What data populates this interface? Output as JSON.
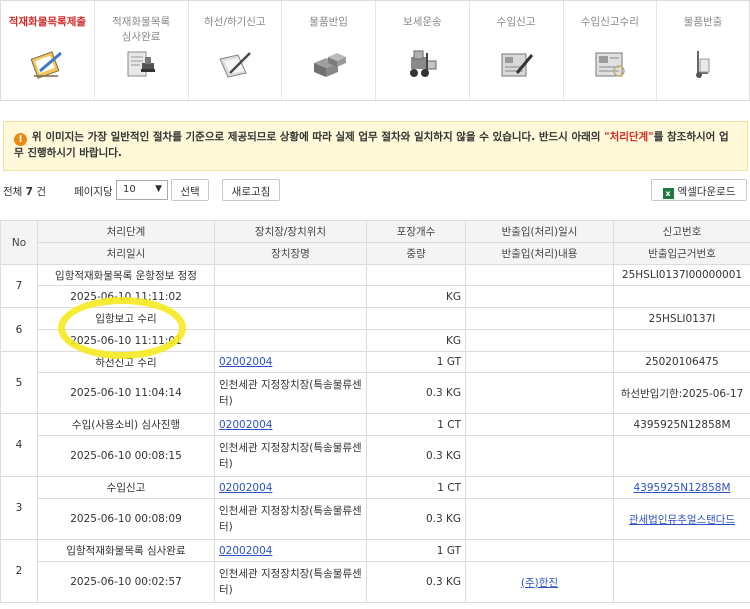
{
  "steps": [
    {
      "label": "적재화물목록제출",
      "icon": "clipboard-pencil-icon",
      "active": true
    },
    {
      "label": "적재화물목록\n심사완료",
      "icon": "document-stamp-icon",
      "active": false
    },
    {
      "label": "하선/하기신고",
      "icon": "folder-pencil-icon",
      "active": false
    },
    {
      "label": "물품반입",
      "icon": "boxes-icon",
      "active": false
    },
    {
      "label": "보세운송",
      "icon": "forklift-icon",
      "active": false
    },
    {
      "label": "수입신고",
      "icon": "form-pen-icon",
      "active": false
    },
    {
      "label": "수입신고수리",
      "icon": "approved-form-icon",
      "active": false
    },
    {
      "label": "물품반출",
      "icon": "hand-truck-icon",
      "active": false
    }
  ],
  "notice": {
    "icon": "warning-icon",
    "text_before": "위 이미지는 가장 일반적인 절차를 기준으로 제공되므로 상황에 따라 실제 업무 절차와 일치하지 않을 수 있습니다. 반드시 아래의 ",
    "highlight": "\"처리단계\"",
    "text_after": "를 참조하시어 업무 진행하시기 바랍니다."
  },
  "toolbar": {
    "total_prefix": "전체",
    "total_count": "7",
    "total_suffix": "건",
    "per_page_label": "페이지당",
    "per_page_value": "10",
    "select_button": "선택",
    "refresh_button": "새로고침",
    "excel_button": "엑셀다운로드"
  },
  "table": {
    "headers_row1": [
      "No",
      "처리단계",
      "장치장/장치위치",
      "포장개수",
      "반출입(처리)일시",
      "신고번호"
    ],
    "headers_row2": [
      "처리일시",
      "장치장명",
      "중량",
      "반출입(처리)내용",
      "반출입근거번호"
    ],
    "rows": [
      {
        "no": "7",
        "step": "입항적재화물목록 운항정보 정정",
        "location_code": "",
        "pkg": "",
        "inout_dt": "",
        "report_no": "25HSLI0137I00000001",
        "datetime": "2025-06-10 11:11:02",
        "location_name": "",
        "weight": "KG",
        "inout_content": "",
        "basis_no": ""
      },
      {
        "no": "6",
        "step": "입항보고 수리",
        "location_code": "",
        "pkg": "",
        "inout_dt": "",
        "report_no": "25HSLI0137I",
        "datetime": "2025-06-10 11:11:01",
        "location_name": "",
        "weight": "KG",
        "inout_content": "",
        "basis_no": ""
      },
      {
        "no": "5",
        "step": "하선신고 수리",
        "location_code": "02002004",
        "pkg": "1 GT",
        "inout_dt": "",
        "report_no": "25020106475",
        "datetime": "2025-06-10 11:04:14",
        "location_name": "인천세관 지정장치장(특송물류센터)",
        "weight": "0.3 KG",
        "inout_content": "",
        "basis_no": "하선반입기한:2025-06-17"
      },
      {
        "no": "4",
        "step": "수입(사용소비) 심사진행",
        "location_code": "02002004",
        "pkg": "1 CT",
        "inout_dt": "",
        "report_no": "4395925N12858M",
        "datetime": "2025-06-10 00:08:15",
        "location_name": "인천세관 지정장치장(특송물류센터)",
        "weight": "0.3 KG",
        "inout_content": "",
        "basis_no": ""
      },
      {
        "no": "3",
        "step": "수입신고",
        "location_code": "02002004",
        "pkg": "1 CT",
        "inout_dt": "",
        "report_no": "4395925N12858M",
        "datetime": "2025-06-10 00:08:09",
        "location_name": "인천세관 지정장치장(특송물류센터)",
        "weight": "0.3 KG",
        "inout_content": "",
        "basis_no": "관세법인뮤추얼스탠다드"
      },
      {
        "no": "2",
        "step": "입항적재화물목록 심사완료",
        "location_code": "02002004",
        "pkg": "1 GT",
        "inout_dt": "",
        "report_no": "",
        "datetime": "2025-06-10 00:02:57",
        "location_name": "인천세관 지정장치장(특송물류센터)",
        "weight": "0.3 KG",
        "inout_content": "(주)한진",
        "basis_no": ""
      }
    ]
  },
  "colors": {
    "accent_red": "#d32a2a",
    "link_blue": "#2d52c7",
    "annotation_yellow": "#f5ea1f"
  }
}
